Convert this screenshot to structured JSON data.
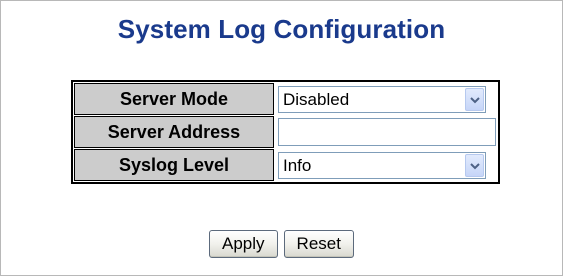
{
  "page": {
    "title": "System Log Configuration"
  },
  "form": {
    "server_mode": {
      "label": "Server Mode",
      "value": "Disabled"
    },
    "server_address": {
      "label": "Server Address",
      "value": ""
    },
    "syslog_level": {
      "label": "Syslog Level",
      "value": "Info"
    }
  },
  "buttons": {
    "apply": "Apply",
    "reset": "Reset"
  },
  "icons": {
    "dropdown": "chevron-down-icon"
  },
  "colors": {
    "title": "#1a3a8c",
    "label_bg": "#cccccc",
    "input_border": "#7f9db9"
  }
}
